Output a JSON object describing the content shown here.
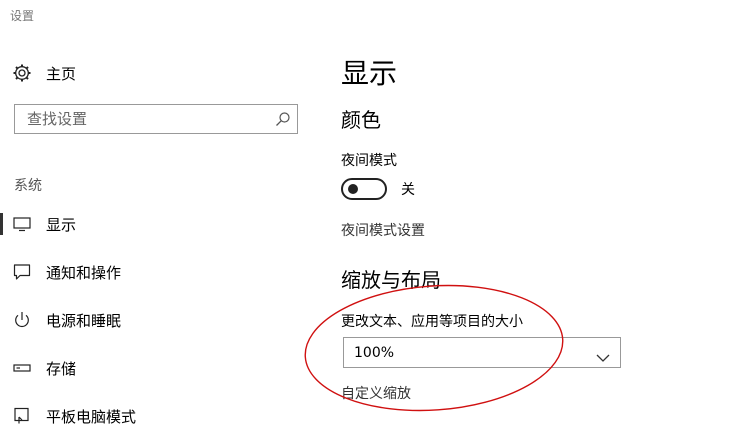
{
  "app": {
    "title": "设置"
  },
  "sidebar": {
    "home": {
      "label": "主页",
      "icon": "gear-icon"
    },
    "search": {
      "placeholder": "查找设置",
      "icon": "search-icon"
    },
    "section_label": "系统",
    "items": [
      {
        "label": "显示",
        "icon": "monitor-icon",
        "selected": true
      },
      {
        "label": "通知和操作",
        "icon": "message-icon",
        "selected": false
      },
      {
        "label": "电源和睡眠",
        "icon": "power-icon",
        "selected": false
      },
      {
        "label": "存储",
        "icon": "storage-icon",
        "selected": false
      },
      {
        "label": "平板电脑模式",
        "icon": "tablet-icon",
        "selected": false
      }
    ]
  },
  "main": {
    "title": "显示",
    "color_section": {
      "heading": "颜色",
      "night_mode_label": "夜间模式",
      "night_mode_state": "关",
      "night_mode_settings_link": "夜间模式设置"
    },
    "scale_section": {
      "heading": "缩放与布局",
      "scale_label": "更改文本、应用等项目的大小",
      "scale_value": "100%",
      "custom_scaling_link": "自定义缩放"
    }
  },
  "colors": {
    "annotation": "#d01010",
    "selected_indicator": "#333333"
  }
}
